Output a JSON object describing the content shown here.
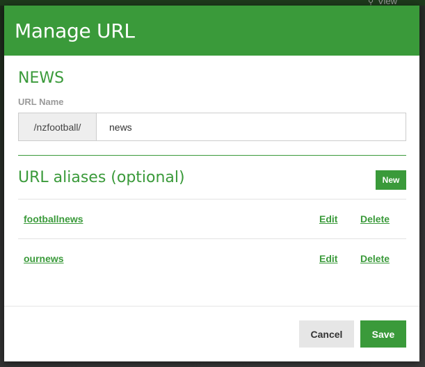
{
  "background": {
    "view_label": "View"
  },
  "modal": {
    "title": "Manage URL",
    "section_name": "NEWS",
    "url_name_label": "URL Name",
    "url_prefix": "/nzfootball/",
    "url_value": "news",
    "aliases_title": "URL aliases (optional)",
    "new_label": "New",
    "aliases": [
      {
        "name": "footballnews",
        "edit_label": "Edit",
        "delete_label": "Delete"
      },
      {
        "name": "ournews",
        "edit_label": "Edit",
        "delete_label": "Delete"
      }
    ],
    "cancel_label": "Cancel",
    "save_label": "Save"
  },
  "colors": {
    "accent": "#3a9a3a",
    "header_bg": "#3a9a3a",
    "cancel_bg": "#e6e6e6"
  }
}
